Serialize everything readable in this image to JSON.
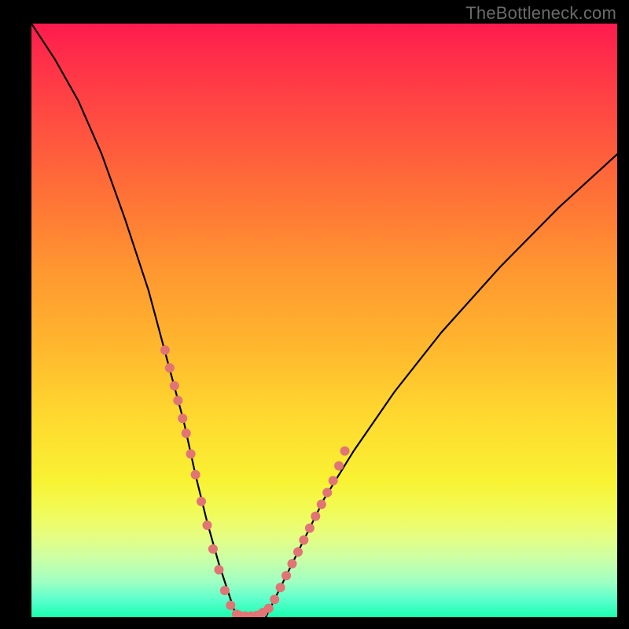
{
  "watermark": "TheBottleneck.com",
  "chart_data": {
    "type": "line",
    "title": "",
    "xlabel": "",
    "ylabel": "",
    "xlim": [
      0,
      100
    ],
    "ylim": [
      0,
      100
    ],
    "grid": false,
    "annotations": [
      "Rainbow gradient background red→yellow→green (top→bottom)"
    ],
    "series": [
      {
        "name": "curve-left",
        "type": "line",
        "x": [
          0,
          4,
          8,
          12,
          16,
          20,
          23,
          26,
          28,
          30,
          32,
          34,
          35
        ],
        "y": [
          100,
          94,
          87,
          78,
          67,
          55,
          44,
          33,
          24,
          16,
          9,
          3,
          0
        ]
      },
      {
        "name": "curve-right",
        "type": "line",
        "x": [
          40,
          42,
          44,
          47,
          50,
          55,
          62,
          70,
          80,
          90,
          100
        ],
        "y": [
          0,
          4,
          8,
          14,
          20,
          28,
          38,
          48,
          59,
          69,
          78
        ]
      },
      {
        "name": "highlight-left",
        "type": "scatter",
        "x": [
          22.8,
          23.6,
          24.4,
          25.0,
          25.8,
          26.4,
          27.2,
          28.0,
          29.0,
          30.0,
          31.0,
          32.0,
          33.0,
          34.0,
          35.0
        ],
        "y": [
          45.0,
          42.0,
          39.0,
          36.5,
          33.5,
          31.0,
          27.5,
          24.0,
          19.5,
          15.5,
          11.5,
          8.0,
          4.5,
          2.0,
          0.5
        ]
      },
      {
        "name": "highlight-bottom",
        "type": "scatter",
        "x": [
          35.5,
          36.5,
          37.5,
          38.5,
          39.5
        ],
        "y": [
          0.3,
          0.2,
          0.2,
          0.3,
          0.8
        ]
      },
      {
        "name": "highlight-right",
        "type": "scatter",
        "x": [
          40.5,
          41.5,
          42.5,
          43.5,
          44.5,
          45.5,
          46.5,
          47.5,
          48.5,
          49.5,
          50.5,
          51.5,
          52.5,
          53.5
        ],
        "y": [
          1.5,
          3.0,
          5.0,
          7.0,
          9.0,
          11.0,
          13.0,
          15.0,
          17.0,
          19.0,
          21.0,
          23.0,
          25.5,
          28.0
        ]
      }
    ],
    "gradient_bands": [
      {
        "y_pct": 0,
        "color": "#ff1a4e"
      },
      {
        "y_pct": 18,
        "color": "#ff5240"
      },
      {
        "y_pct": 42,
        "color": "#ff9830"
      },
      {
        "y_pct": 66,
        "color": "#ffd82f"
      },
      {
        "y_pct": 82,
        "color": "#f1fb56"
      },
      {
        "y_pct": 94,
        "color": "#a0ffc2"
      },
      {
        "y_pct": 100,
        "color": "#18ffae"
      }
    ]
  },
  "colors": {
    "curve": "#000000",
    "dot": "#e17474",
    "background_frame": "#000000",
    "watermark": "#6a6a6a"
  }
}
